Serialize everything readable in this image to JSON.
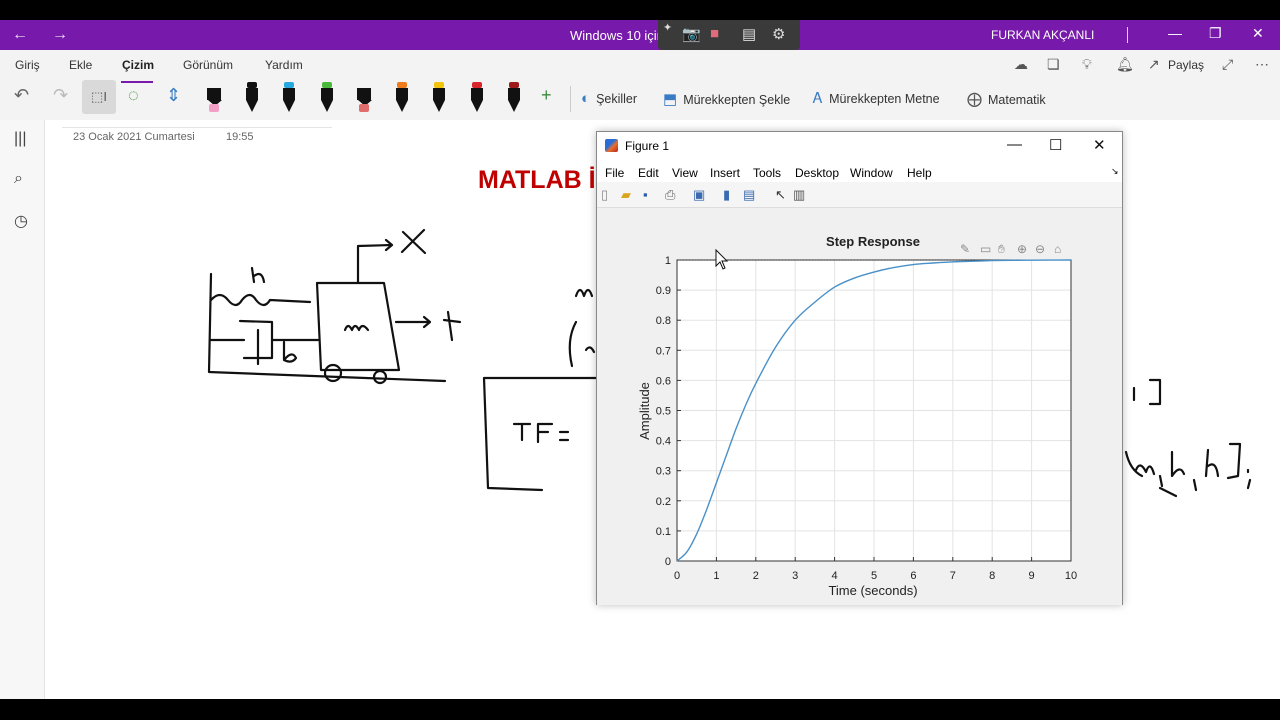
{
  "window": {
    "title": "Windows 10 için",
    "user": "FURKAN AKÇANLI",
    "nav_back_icon": "←",
    "nav_forward_icon": "→",
    "minimize_glyph": "—",
    "maximize_glyph": "❐",
    "close_glyph": "✕"
  },
  "capture_bar": {
    "pin": "✦",
    "camera": "📷",
    "video": "■",
    "gallery": "▤",
    "settings": "⚙"
  },
  "ribbon": {
    "tabs": [
      "Giriş",
      "Ekle",
      "Çizim",
      "Görünüm",
      "Yardım"
    ],
    "active_tab": "Çizim",
    "share_label": "Paylaş",
    "shapes_label": "Şekiller",
    "ink_to_shape_label": "Mürekkepten Şekle",
    "ink_to_text_label": "Mürekkepten Metne",
    "math_label": "Matematik",
    "pens": [
      {
        "cap": "#f4a0c6",
        "kind": "highlighter"
      },
      {
        "cap": "#111111",
        "kind": "pen"
      },
      {
        "cap": "#29a8e0",
        "kind": "pen"
      },
      {
        "cap": "#49b83b",
        "kind": "pen"
      },
      {
        "cap": "#e26d6d",
        "kind": "highlighter"
      },
      {
        "cap": "#ee7b1c",
        "kind": "pen"
      },
      {
        "cap": "#f2c40c",
        "kind": "pen"
      },
      {
        "cap": "#d8262c",
        "kind": "pen"
      },
      {
        "cap": "#9e1a1a",
        "kind": "pen"
      }
    ],
    "add_pen_glyph": "+"
  },
  "page": {
    "date": "23 Ocak 2021 Cumartesi",
    "time": "19:55",
    "title_visible": "MATLAB İ",
    "accent": "#c00000"
  },
  "figure": {
    "title": "Figure 1",
    "menu": [
      "File",
      "Edit",
      "View",
      "Insert",
      "Tools",
      "Desktop",
      "Window",
      "Help"
    ],
    "minimize_glyph": "—",
    "maximize_glyph": "☐",
    "close_glyph": "✕"
  },
  "chart_data": {
    "type": "line",
    "title": "Step Response",
    "xlabel": "Time (seconds)",
    "ylabel": "Amplitude",
    "xlim": [
      0,
      10
    ],
    "ylim": [
      0,
      1
    ],
    "xticks": [
      "0",
      "1",
      "2",
      "3",
      "4",
      "5",
      "6",
      "7",
      "8",
      "9",
      "10"
    ],
    "yticks": [
      "0",
      "0.1",
      "0.2",
      "0.3",
      "0.4",
      "0.5",
      "0.6",
      "0.7",
      "0.8",
      "0.9",
      "1"
    ],
    "grid": true,
    "color": "#4a90c8",
    "reference_line": 1,
    "series": [
      {
        "x": [
          0,
          0.25,
          0.5,
          0.75,
          1,
          1.25,
          1.5,
          1.75,
          2,
          2.5,
          3,
          3.5,
          4,
          4.5,
          5,
          5.5,
          6,
          6.5,
          7,
          7.5,
          8,
          8.5,
          9,
          9.5,
          10
        ],
        "y": [
          0,
          0.03,
          0.09,
          0.17,
          0.26,
          0.35,
          0.44,
          0.52,
          0.59,
          0.71,
          0.8,
          0.86,
          0.91,
          0.94,
          0.96,
          0.975,
          0.985,
          0.99,
          0.994,
          0.996,
          0.998,
          0.999,
          0.9995,
          0.9998,
          1.0
        ]
      }
    ]
  }
}
